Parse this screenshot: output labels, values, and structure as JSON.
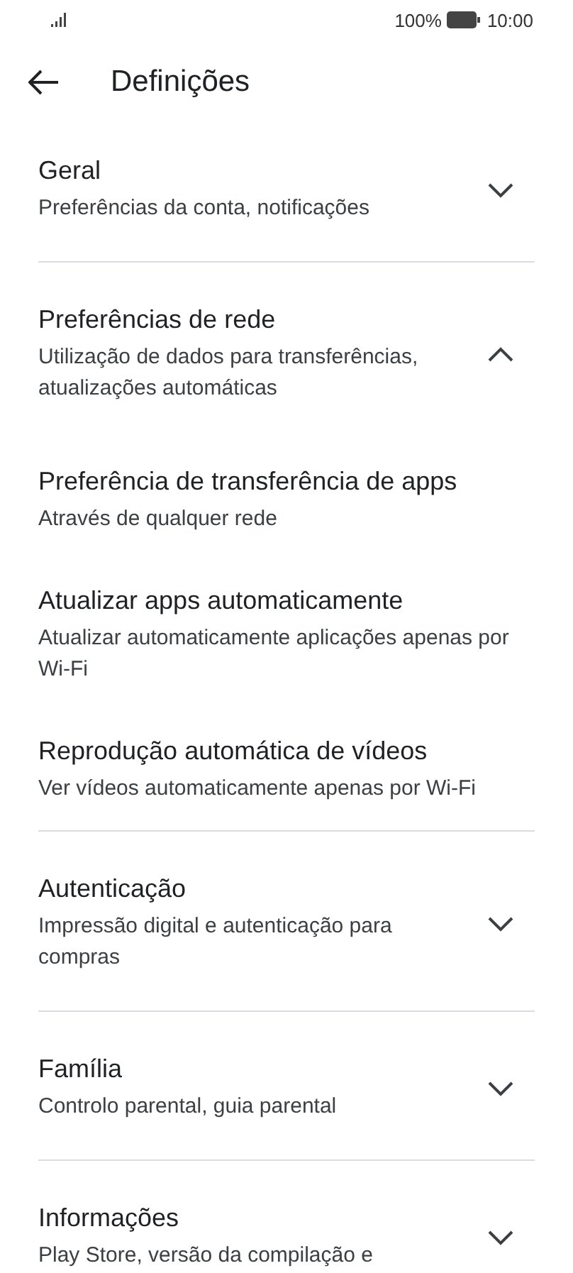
{
  "status_bar": {
    "battery_text": "100%",
    "time": "10:00"
  },
  "header": {
    "title": "Definições"
  },
  "sections": [
    {
      "title": "Geral",
      "subtitle": "Preferências da conta, notificações",
      "expanded": false
    },
    {
      "title": "Preferências de rede",
      "subtitle": "Utilização de dados para transferências, atualizações automáticas",
      "expanded": true,
      "items": [
        {
          "title": "Preferência de transferência de apps",
          "subtitle": "Através de qualquer rede"
        },
        {
          "title": "Atualizar apps automaticamente",
          "subtitle": "Atualizar automaticamente aplicações apenas por Wi-Fi"
        },
        {
          "title": "Reprodução automática de vídeos",
          "subtitle": "Ver vídeos automaticamente apenas por Wi-Fi"
        }
      ]
    },
    {
      "title": "Autenticação",
      "subtitle": "Impressão digital e autenticação para compras",
      "expanded": false
    },
    {
      "title": "Família",
      "subtitle": "Controlo parental, guia parental",
      "expanded": false
    },
    {
      "title": "Informações",
      "subtitle": "Play Store, versão da compilação e",
      "expanded": false
    }
  ]
}
